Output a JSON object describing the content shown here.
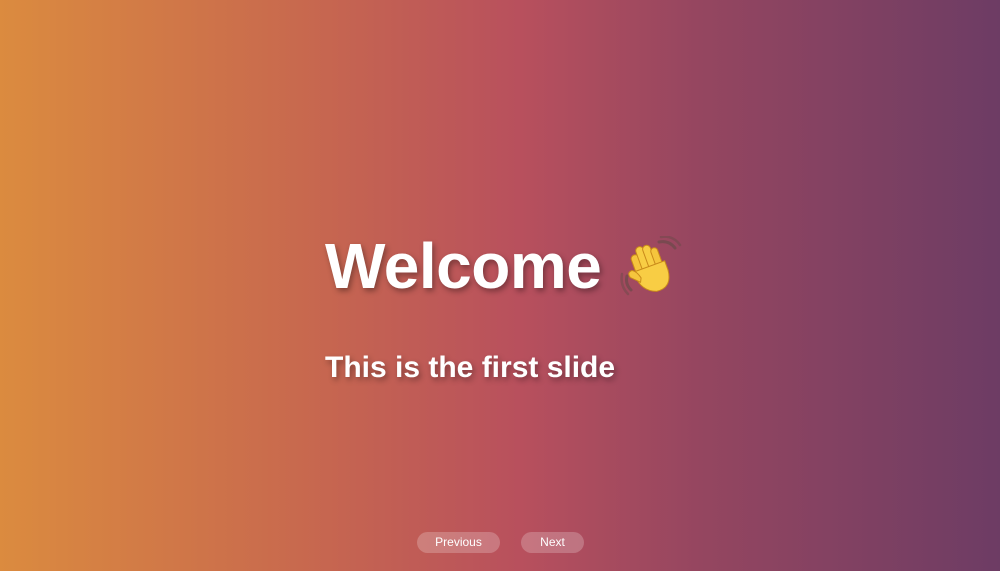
{
  "slide": {
    "title": "Welcome",
    "title_icon": "waving-hand-icon",
    "subtitle": "This is the first slide"
  },
  "navigation": {
    "previous_label": "Previous",
    "next_label": "Next"
  },
  "colors": {
    "gradient_start": "#db8b3f",
    "gradient_mid": "#b8505d",
    "gradient_end": "#6d3c64",
    "text": "#ffffff"
  }
}
